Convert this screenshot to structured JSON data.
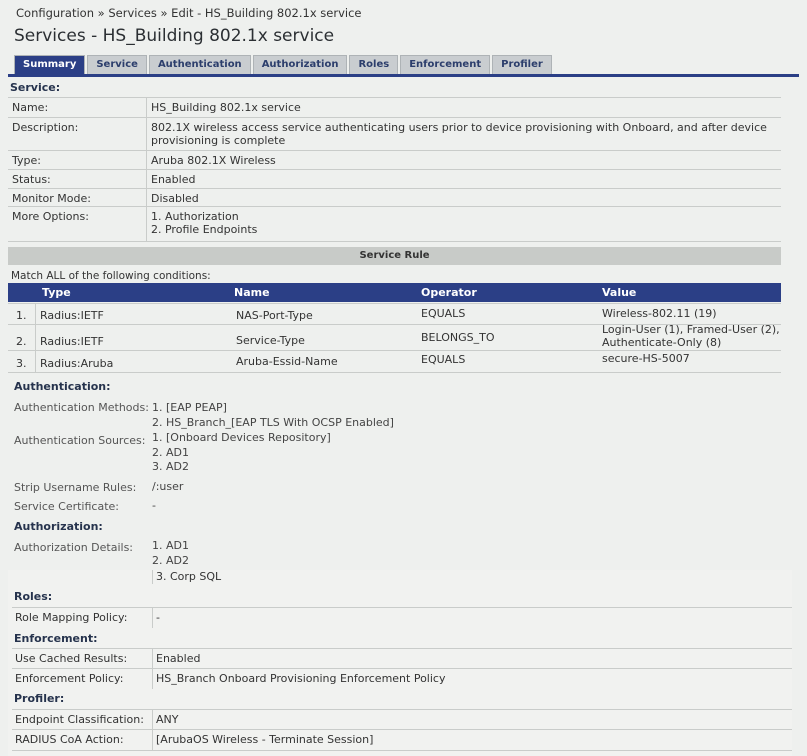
{
  "breadcrumb": "Configuration » Services » Edit - HS_Building 802.1x service",
  "page_title": "Services - HS_Building 802.1x service",
  "tabs": [
    "Summary",
    "Service",
    "Authentication",
    "Authorization",
    "Roles",
    "Enforcement",
    "Profiler"
  ],
  "active_tab": "Summary",
  "service": {
    "heading": "Service:",
    "rows": [
      {
        "label": "Name:",
        "value": "HS_Building 802.1x service"
      },
      {
        "label": "Description:",
        "value": "802.1X wireless access service authenticating users prior to device provisioning with Onboard, and after device provisioning is complete"
      },
      {
        "label": "Type:",
        "value": "Aruba 802.1X Wireless"
      },
      {
        "label": "Status:",
        "value": "Enabled"
      },
      {
        "label": "Monitor Mode:",
        "value": "Disabled"
      },
      {
        "label": "More Options:",
        "value": "1. Authorization",
        "value2": "2. Profile Endpoints"
      }
    ]
  },
  "service_rule": {
    "title": "Service Rule",
    "match_text": "Match ALL of the following conditions:",
    "columns": [
      "Type",
      "Name",
      "Operator",
      "Value"
    ],
    "rows": [
      {
        "num": "1.",
        "type": "Radius:IETF",
        "name": "NAS-Port-Type",
        "operator": "EQUALS",
        "value": "Wireless-802.11 (19)",
        "value2": ""
      },
      {
        "num": "2.",
        "type": "Radius:IETF",
        "name": "Service-Type",
        "operator": "BELONGS_TO",
        "value": "Login-User (1), Framed-User (2),",
        "value2": "Authenticate-Only (8)"
      },
      {
        "num": "3.",
        "type": "Radius:Aruba",
        "name": "Aruba-Essid-Name",
        "operator": "EQUALS",
        "value": "secure-HS-5007",
        "value2": ""
      }
    ]
  },
  "authentication": {
    "heading": "Authentication:",
    "methods_label": "Authentication Methods:",
    "methods": [
      "1. [EAP PEAP]",
      "2. HS_Branch_[EAP TLS With OCSP Enabled]"
    ],
    "sources_label": "Authentication Sources:",
    "sources": [
      "1. [Onboard Devices Repository]",
      "2. AD1",
      "3. AD2"
    ],
    "strip_label": "Strip Username Rules:",
    "strip_value": "/:user",
    "cert_label": "Service Certificate:",
    "cert_value": "-"
  },
  "authorization": {
    "heading": "Authorization:",
    "details_label": "Authorization Details:",
    "details": [
      "1. AD1",
      "2. AD2",
      "3. Corp SQL"
    ]
  },
  "roles": {
    "heading": "Roles:",
    "mapping_label": "Role Mapping Policy:",
    "mapping_value": "-"
  },
  "enforcement": {
    "heading": "Enforcement:",
    "cached_label": "Use Cached Results:",
    "cached_value": "Enabled",
    "policy_label": "Enforcement Policy:",
    "policy_value": "HS_Branch Onboard Provisioning Enforcement Policy"
  },
  "profiler": {
    "heading": "Profiler:",
    "class_label": "Endpoint Classification:",
    "class_value": "ANY",
    "coa_label": "RADIUS CoA Action:",
    "coa_value": "[ArubaOS Wireless - Terminate Session]"
  }
}
